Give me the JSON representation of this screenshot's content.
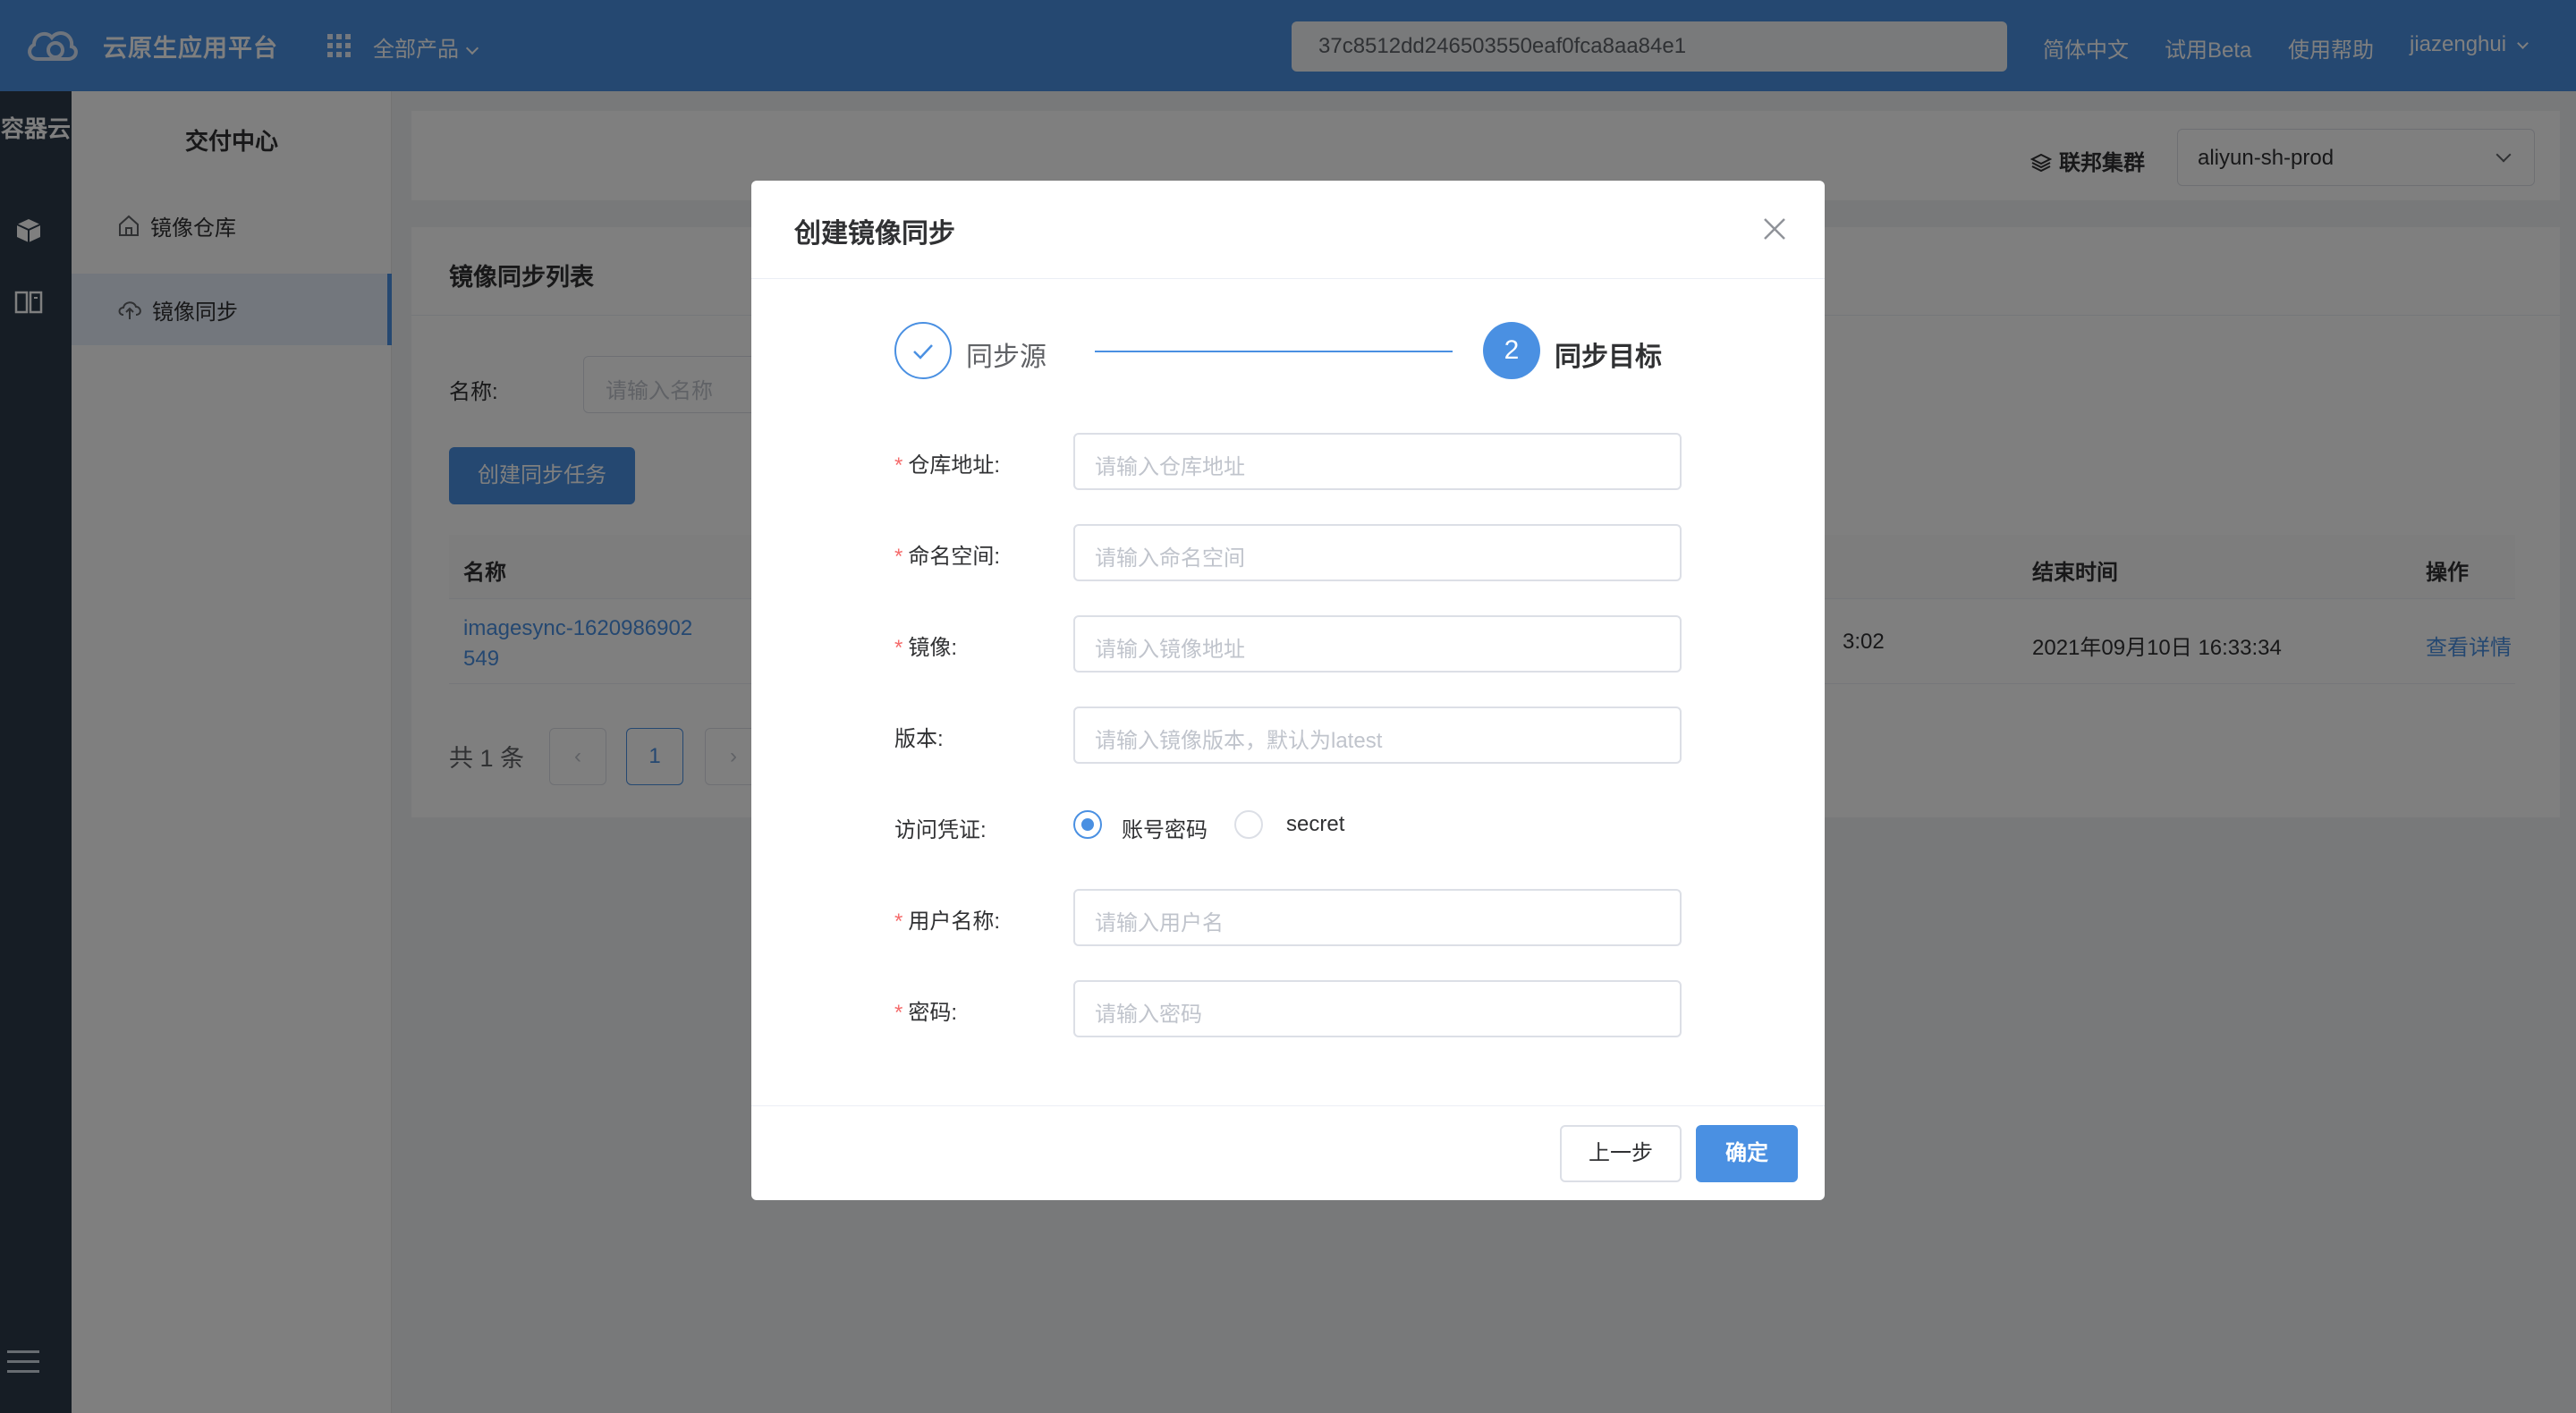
{
  "header": {
    "brand": "云原生应用平台",
    "all_products": "全部产品",
    "search_value": "37c8512dd246503550eaf0fca8aa84e1",
    "lang": "简体中文",
    "beta": "试用Beta",
    "help": "使用帮助",
    "user": "jiazenghui",
    "icons": [
      "cloud-logo-icon",
      "grid-apps-icon",
      "chevron-down-icon"
    ]
  },
  "rail": {
    "title": "容器云",
    "icons": [
      "box-icon",
      "book-icon",
      "menu-icon"
    ]
  },
  "sidebar": {
    "title": "交付中心",
    "items": [
      {
        "label": "镜像仓库",
        "icon": "home-icon",
        "active": false
      },
      {
        "label": "镜像同步",
        "icon": "cloud-sync-icon",
        "active": true
      }
    ]
  },
  "filter": {
    "federation_label": "联邦集群",
    "federation_value": "aliyun-sh-prod"
  },
  "list": {
    "title": "镜像同步列表",
    "name_label": "名称:",
    "name_placeholder": "请输入名称",
    "create_button": "创建同步任务",
    "columns": [
      "名称",
      "结束时间",
      "操作"
    ],
    "rows": [
      {
        "name_line1": "imagesync-1620986902",
        "name_line2": "549",
        "partial_time": "3:02",
        "end_time": "2021年09月10日 16:33:34",
        "action": "查看详情"
      }
    ],
    "total": "共 1 条",
    "pagination": {
      "prev": "‹",
      "current": "1",
      "next": "›"
    }
  },
  "modal": {
    "title": "创建镜像同步",
    "steps": [
      {
        "label": "同步源",
        "status": "done"
      },
      {
        "number": "2",
        "label": "同步目标",
        "status": "active"
      }
    ],
    "fields": {
      "repo": {
        "label": "仓库地址:",
        "placeholder": "请输入仓库地址",
        "required": true
      },
      "namespace": {
        "label": "命名空间:",
        "placeholder": "请输入命名空间",
        "required": true
      },
      "image": {
        "label": "镜像:",
        "placeholder": "请输入镜像地址",
        "required": true
      },
      "version": {
        "label": "版本:",
        "placeholder": "请输入镜像版本，默认为latest",
        "required": false
      },
      "credential": {
        "label": "访问凭证:",
        "options": [
          "账号密码",
          "secret"
        ],
        "selected": "账号密码"
      },
      "username": {
        "label": "用户名称:",
        "placeholder": "请输入用户名",
        "required": true
      },
      "password": {
        "label": "密码:",
        "placeholder": "请输入密码",
        "required": true
      }
    },
    "prev_button": "上一步",
    "ok_button": "确定"
  },
  "colors": {
    "primary": "#4a90e2",
    "required": "#f56c6c",
    "rail": "#2d3a4b"
  }
}
